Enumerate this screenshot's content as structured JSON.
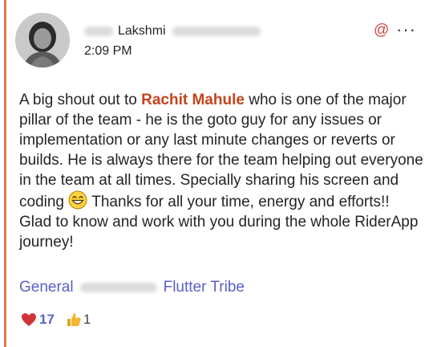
{
  "author": {
    "name": "Lakshmi",
    "time": "2:09 PM"
  },
  "message": {
    "intro": "A big shout out to ",
    "mention": "Rachit Mahule",
    "body": " who is one of the major pillar of the team - he is the goto guy for any issues or implementation or any last minute changes or reverts or builds. He is always there for the team helping out everyone in the team at all times. Specially sharing his screen and coding ",
    "outro": " Thanks for all your time, energy and efforts!! Glad to know and work with you during the whole RiderApp journey!"
  },
  "tags": {
    "first": "General",
    "last": "Flutter Tribe"
  },
  "reactions": {
    "heart_count": "17",
    "like_count": "1"
  },
  "icons": {
    "mention": "at-sign-icon",
    "more": "more-options-icon",
    "emoji": "grinning-face-icon",
    "heart": "heart-icon",
    "like": "thumbs-up-icon"
  },
  "colors": {
    "accent_bar": "#e97548",
    "mention_text": "#c4441c",
    "link": "#5b5fc7",
    "heart": "#d13438",
    "like": "#f2b632"
  }
}
